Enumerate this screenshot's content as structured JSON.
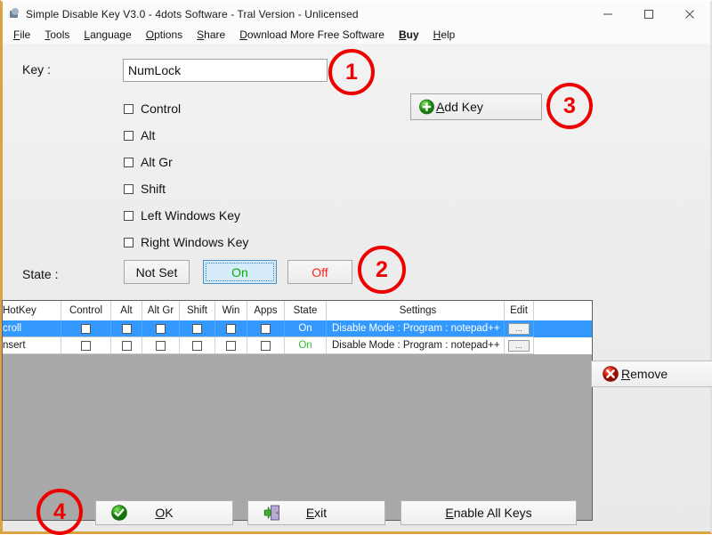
{
  "window": {
    "title": "Simple Disable Key V3.0 - 4dots Software - Tral Version - Unlicensed",
    "icon": "app-keyboard-icon",
    "controls": {
      "minimize": "minimize-icon",
      "maximize": "maximize-icon",
      "close": "close-icon"
    }
  },
  "menubar": {
    "items": [
      {
        "label": "File",
        "mnemonic": "F",
        "bold": false
      },
      {
        "label": "Tools",
        "mnemonic": "T",
        "bold": false
      },
      {
        "label": "Language",
        "mnemonic": "L",
        "bold": false
      },
      {
        "label": "Options",
        "mnemonic": "O",
        "bold": false
      },
      {
        "label": "Share",
        "mnemonic": "S",
        "bold": false
      },
      {
        "label": "Download More Free Software",
        "mnemonic": "D",
        "bold": false
      },
      {
        "label": "Buy",
        "mnemonic": "B",
        "bold": true
      },
      {
        "label": "Help",
        "mnemonic": "H",
        "bold": false
      }
    ]
  },
  "form": {
    "key_label": "Key :",
    "key_value": "NumLock",
    "key_placeholder": "",
    "modifiers": [
      {
        "label": "Control",
        "checked": false
      },
      {
        "label": "Alt",
        "checked": false
      },
      {
        "label": "Alt Gr",
        "checked": false
      },
      {
        "label": "Shift",
        "checked": false
      },
      {
        "label": "Left Windows Key",
        "checked": false
      },
      {
        "label": "Right Windows Key",
        "checked": false
      }
    ],
    "add_key_label": "Add Key",
    "add_key_icon": "green-plus-icon",
    "state_label": "State :",
    "state_buttons": [
      {
        "label": "Not Set",
        "selected": false,
        "color": "#111111"
      },
      {
        "label": "On",
        "selected": true,
        "color": "#00b000"
      },
      {
        "label": "Off",
        "selected": false,
        "color": "#ff2020"
      }
    ]
  },
  "grid": {
    "columns": [
      "HotKey",
      "Control",
      "Alt",
      "Alt Gr",
      "Shift",
      "Win",
      "Apps",
      "State",
      "Settings",
      "Edit"
    ],
    "rows": [
      {
        "hotkey": "croll",
        "control": false,
        "alt": false,
        "altgr": false,
        "shift": false,
        "win": false,
        "apps": false,
        "state": "On",
        "settings": "Disable Mode : Program : notepad++",
        "edit": "...",
        "selected": true
      },
      {
        "hotkey": "nsert",
        "control": false,
        "alt": false,
        "altgr": false,
        "shift": false,
        "win": false,
        "apps": false,
        "state": "On",
        "settings": "Disable Mode : Program : notepad++",
        "edit": "...",
        "selected": false
      }
    ]
  },
  "remove": {
    "label": "Remove",
    "mnemonic": "R",
    "icon": "red-x-circle-icon"
  },
  "footer": {
    "ok_label": "OK",
    "ok_mnemonic": "O",
    "ok_icon": "green-check-icon",
    "exit_label": "Exit",
    "exit_mnemonic": "E",
    "exit_icon": "exit-door-icon",
    "enable_all_label": "Enable All Keys",
    "enable_all_mnemonic": "E"
  },
  "annotations": [
    {
      "number": "1",
      "target": "key-input"
    },
    {
      "number": "2",
      "target": "state-buttons"
    },
    {
      "number": "3",
      "target": "add-key-button"
    },
    {
      "number": "4",
      "target": "footer-buttons"
    }
  ],
  "colors": {
    "annotation": "#ee0000",
    "selection": "#3399ff",
    "state_on": "#00b000",
    "state_off": "#ff2020",
    "window_accent": "#d9a441"
  }
}
